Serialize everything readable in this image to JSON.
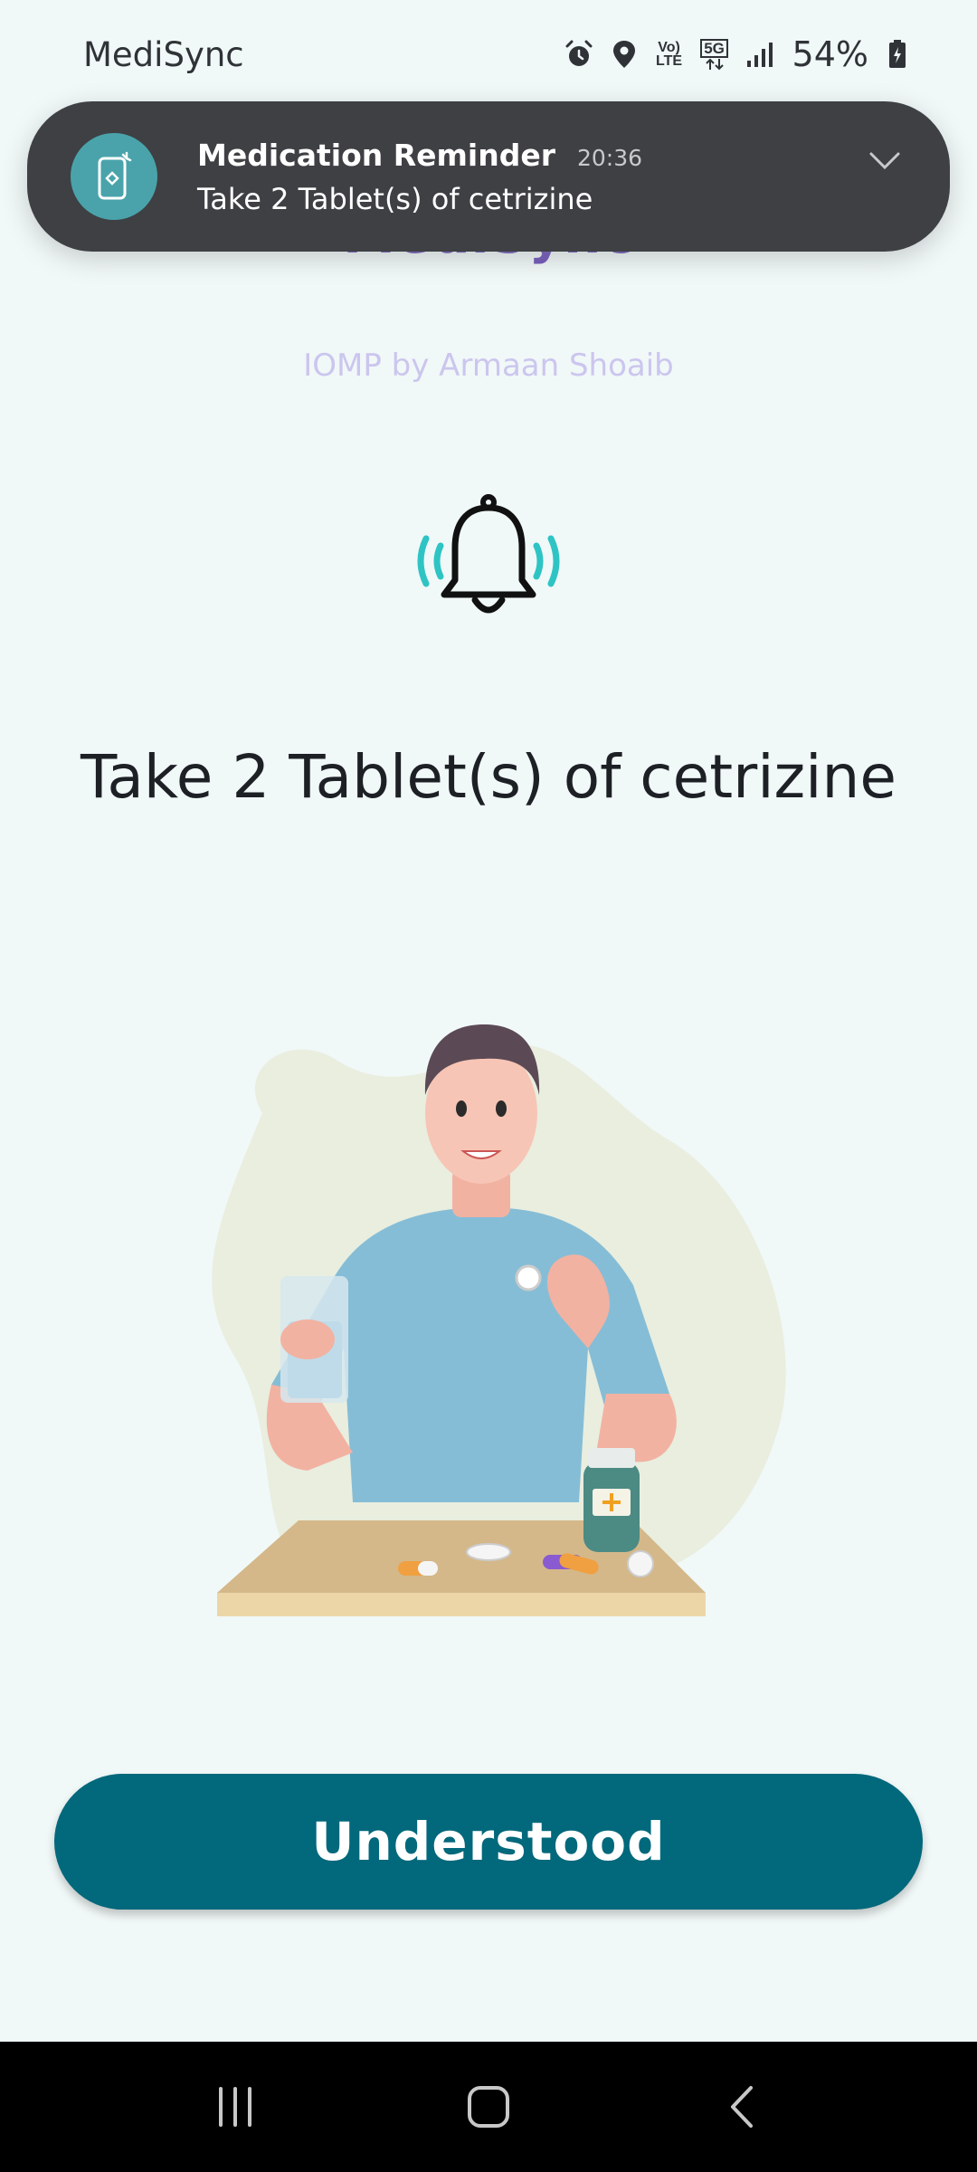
{
  "status_bar": {
    "app_name": "MediSync",
    "volte_label": "Vo) LTE",
    "network_label": "5G",
    "battery_percent": "54%",
    "icons": [
      "alarm-icon",
      "location-icon",
      "volte-icon",
      "5g-data-icon",
      "signal-icon",
      "battery-charging-icon"
    ]
  },
  "notification": {
    "title": "Medication Reminder",
    "time": "20:36",
    "body": "Take 2 Tablet(s) of cetrizine",
    "icon": "phone-reminder-icon"
  },
  "app": {
    "title": "MediSync",
    "subtitle": "IOMP by Armaan Shoaib"
  },
  "reminder": {
    "icon": "ringing-bell-icon",
    "message": "Take 2 Tablet(s) of cetrizine",
    "illustration": "man-taking-medicine-illustration"
  },
  "actions": {
    "understood_label": "Understood"
  },
  "nav_bar": {
    "icons": [
      "recent-apps-icon",
      "home-icon",
      "back-icon"
    ]
  },
  "colors": {
    "background": "#f1f8f8",
    "primary": "#02687b",
    "title_purple": "#4a25a6",
    "notification_bg": "#3e4044",
    "bell_waves": "#2ec4c4"
  }
}
